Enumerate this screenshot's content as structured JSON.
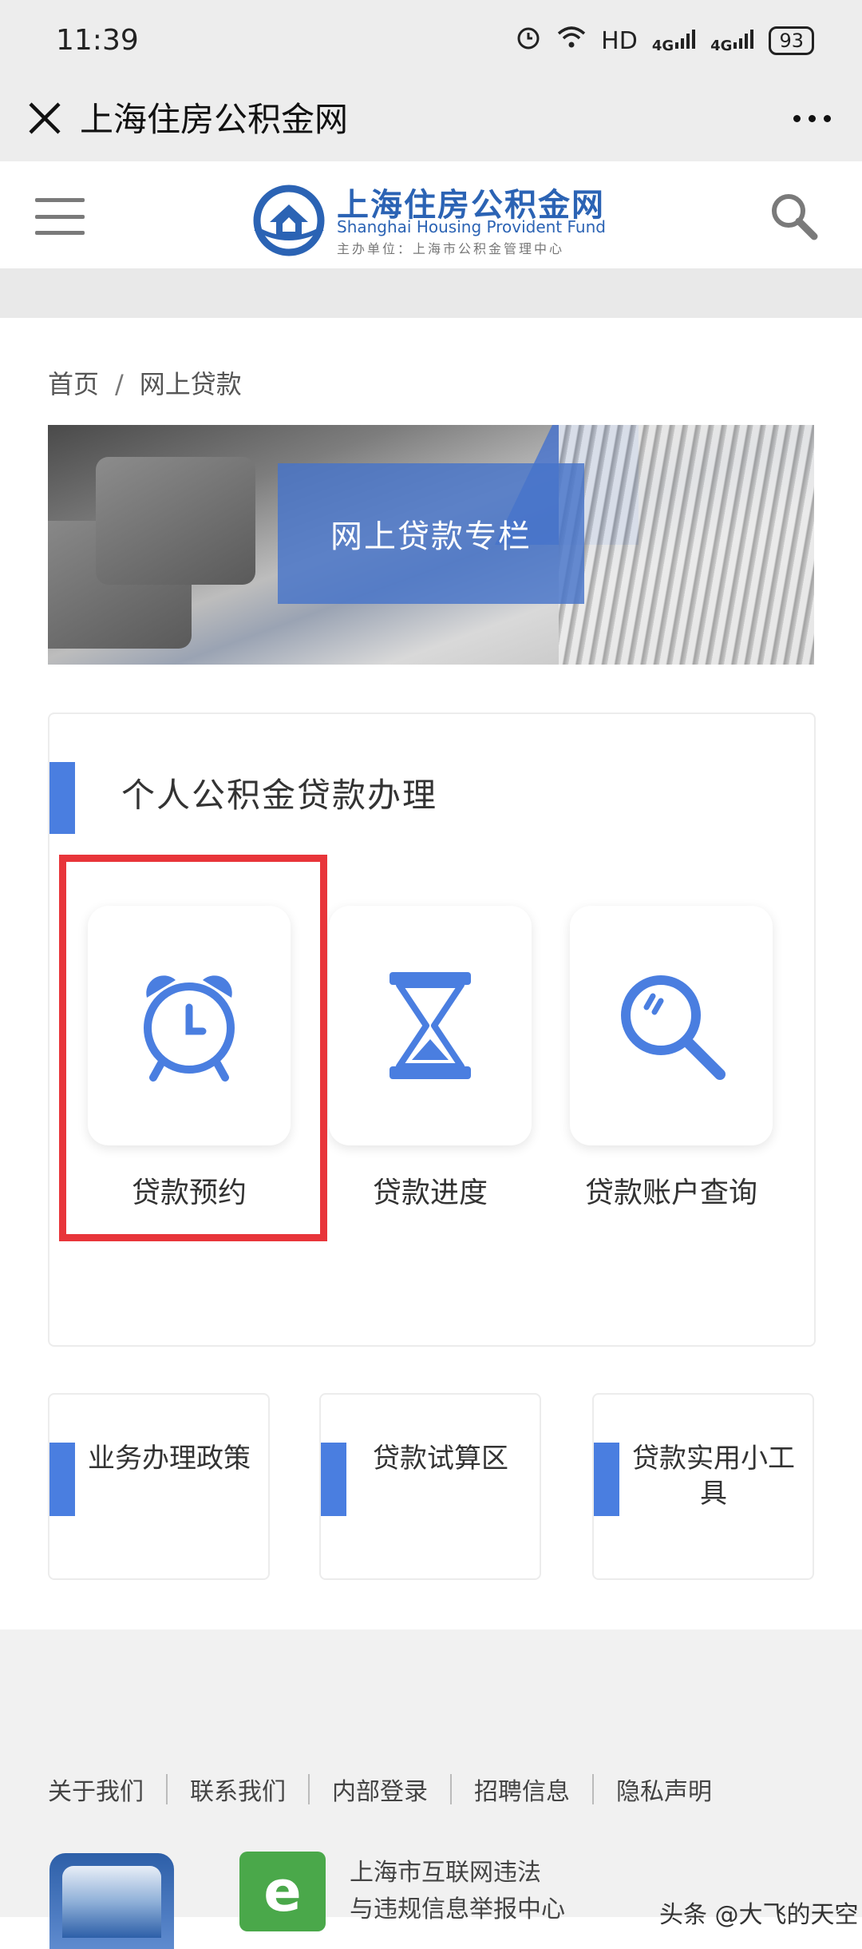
{
  "status_bar": {
    "time": "11:39",
    "network": "HD",
    "signal1": "4G",
    "signal2": "4G",
    "battery": "93"
  },
  "titlebar": {
    "title": "上海住房公积金网"
  },
  "site_header": {
    "logo_cn": "上海住房公积金网",
    "logo_en": "Shanghai Housing Provident Fund",
    "logo_sub": "主办单位：上海市公积金管理中心"
  },
  "breadcrumb": {
    "home": "首页",
    "separator": "/",
    "current": "网上贷款"
  },
  "banner": {
    "title": "网上贷款专栏"
  },
  "loan_section": {
    "title": "个人公积金贷款办理",
    "items": [
      {
        "label": "贷款预约",
        "icon": "alarm-clock-icon"
      },
      {
        "label": "贷款进度",
        "icon": "hourglass-icon"
      },
      {
        "label": "贷款账户查询",
        "icon": "magnifier-icon"
      }
    ]
  },
  "quick_links": [
    {
      "label": "业务办理政策"
    },
    {
      "label": "贷款试算区"
    },
    {
      "label": "贷款实用小工具"
    }
  ],
  "footer": {
    "links": [
      "关于我们",
      "联系我们",
      "内部登录",
      "招聘信息",
      "隐私声明"
    ],
    "report_line1": "上海市互联网违法",
    "report_line2": "与违规信息举报中心",
    "watermark": "头条 @大飞的天空"
  },
  "colors": {
    "accent_blue": "#4a7ee0",
    "logo_blue": "#2b63b4",
    "highlight_red": "#e8353a"
  }
}
